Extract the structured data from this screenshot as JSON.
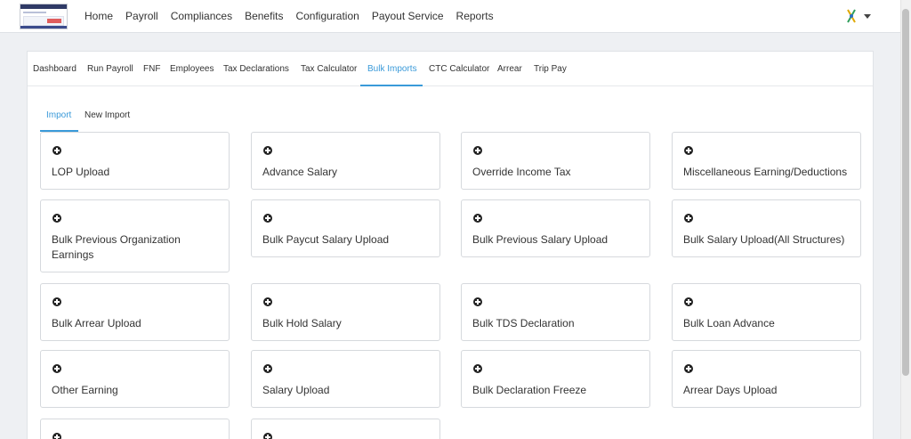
{
  "nav": {
    "items": [
      "Home",
      "Payroll",
      "Compliances",
      "Benefits",
      "Configuration",
      "Payout Service",
      "Reports"
    ]
  },
  "subnav": {
    "tabs": [
      "Dashboard",
      "Run Payroll",
      "FNF",
      "Employees",
      "Tax Declarations",
      "Tax Calculator",
      "Bulk Imports",
      "CTC Calculator",
      "Arrear",
      "Trip Pay"
    ],
    "active": "Bulk Imports"
  },
  "import_tabs": {
    "tabs": [
      "Import",
      "New Import"
    ],
    "active": "Import"
  },
  "cards": [
    "LOP Upload",
    "Advance Salary",
    "Override Income Tax",
    "Miscellaneous Earning/Deductions",
    "Bulk Previous Organization Earnings",
    "Bulk Paycut Salary Upload",
    "Bulk Previous Salary Upload",
    "Bulk Salary Upload(All Structures)",
    "Bulk Arrear Upload",
    "Bulk Hold Salary",
    "Bulk TDS Declaration",
    "Bulk Loan Advance",
    "Other Earning",
    "Salary Upload",
    "Bulk Declaration Freeze",
    "Arrear Days Upload",
    "",
    ""
  ],
  "colors": {
    "accent": "#3a9ad9",
    "background": "#eef0f3"
  }
}
